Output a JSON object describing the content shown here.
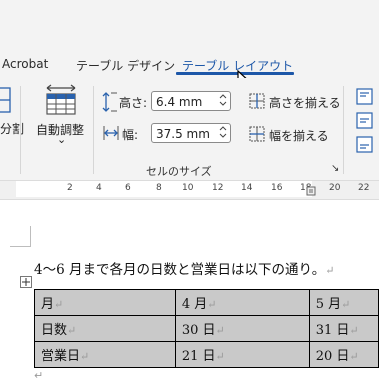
{
  "ribbon_tabs": [
    {
      "label": "Acrobat"
    },
    {
      "label": "テーブル デザイン"
    },
    {
      "label": "テーブル レイアウト",
      "active": true
    }
  ],
  "ribbon": {
    "split_label": "分割",
    "autofit_label": "自動調整",
    "autofit_chevron": "⌄",
    "height_label": "高さ:",
    "height_value": "6.4 mm",
    "width_label": "幅:",
    "width_value": "37.5 mm",
    "distribute_rows_label": "高さを揃える",
    "distribute_cols_label": "幅を揃える",
    "cell_size_group_title": "セルのサイズ",
    "dialog_launcher": "↘"
  },
  "ruler": {
    "ticks": [
      "2",
      "4",
      "6",
      "8",
      "10",
      "12",
      "14",
      "16",
      "18",
      "20",
      "22"
    ]
  },
  "document": {
    "paragraph_mark": "↵",
    "sentence": "4～6 月まで各月の日数と営業日は以下の通り。",
    "table": {
      "rows": [
        [
          "月",
          "4 月",
          "5 月"
        ],
        [
          "日数",
          "30 日",
          "31 日"
        ],
        [
          "営業日",
          "21 日",
          "20 日"
        ]
      ]
    }
  },
  "colors": {
    "accent": "#1d57a8",
    "ribbon_bg": "#f3f3f3",
    "table_shading": "#c9c9c9"
  }
}
